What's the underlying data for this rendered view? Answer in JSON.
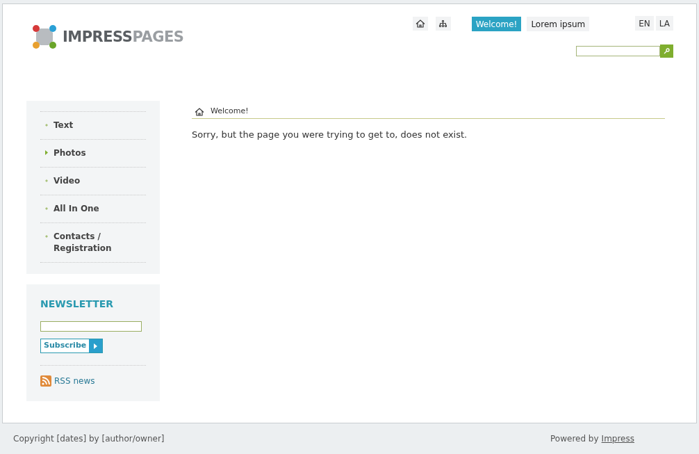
{
  "logo": {
    "text_primary": "IMPRESS",
    "text_secondary": "PAGES"
  },
  "top_nav": [
    {
      "label": "Welcome!",
      "selected": true
    },
    {
      "label": "Lorem ipsum",
      "selected": false
    }
  ],
  "languages": [
    {
      "label": "EN"
    },
    {
      "label": "LA"
    }
  ],
  "menu": [
    {
      "label": "Text",
      "selected": false
    },
    {
      "label": "Photos",
      "selected": true
    },
    {
      "label": "Video",
      "selected": false
    },
    {
      "label": "All In One",
      "selected": false
    },
    {
      "label": "Contacts / Registration",
      "selected": false
    }
  ],
  "newsletter": {
    "title": "NEWSLETTER",
    "button": "Subscribe",
    "rss": "RSS news"
  },
  "breadcrumb": "Welcome!",
  "message": "Sorry, but the page you were trying to get to, does not exist.",
  "footer": {
    "copyright": "Copyright [dates] by [author/owner]",
    "powered_by": "Powered by",
    "link": "Impress"
  }
}
